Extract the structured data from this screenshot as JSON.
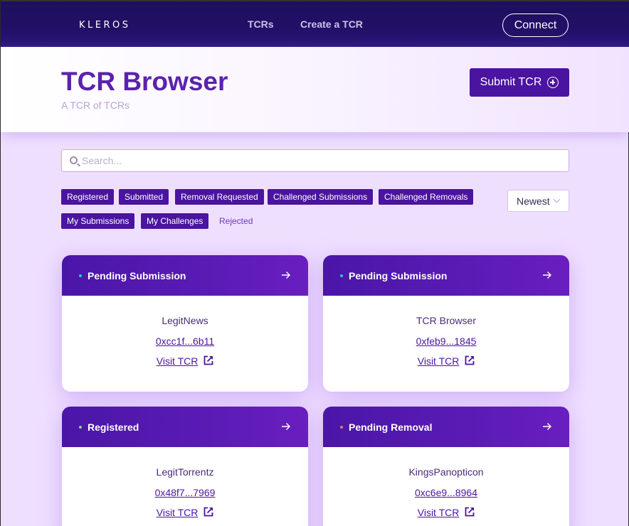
{
  "topbar": {
    "logo": "KLEROS",
    "nav": [
      {
        "label": "TCRs"
      },
      {
        "label": "Create a TCR"
      }
    ],
    "connect_label": "Connect"
  },
  "hero": {
    "title": "TCR Browser",
    "subtitle": "A TCR of TCRs",
    "submit_label": "Submit TCR"
  },
  "search": {
    "placeholder": "Search..."
  },
  "filters": [
    {
      "label": "Registered",
      "active": true
    },
    {
      "label": "Submitted",
      "active": true
    },
    {
      "label": "Removal Requested",
      "active": true
    },
    {
      "label": "Challenged Submissions",
      "active": true
    },
    {
      "label": "Challenged Removals",
      "active": true
    },
    {
      "label": "My Submissions",
      "active": true
    },
    {
      "label": "My Challenges",
      "active": true
    },
    {
      "label": "Rejected",
      "active": false
    }
  ],
  "sort": {
    "selected": "Newest"
  },
  "cards": [
    {
      "status": "Pending Submission",
      "status_color": "#1bd0d8",
      "name": "LegitNews",
      "address": "0xcc1f...6b11",
      "visit_label": "Visit TCR"
    },
    {
      "status": "Pending Submission",
      "status_color": "#1bd0d8",
      "name": "TCR Browser",
      "address": "0xfeb9...1845",
      "visit_label": "Visit TCR"
    },
    {
      "status": "Registered",
      "status_color": "#7be07b",
      "name": "LegitTorrentz",
      "address": "0x48f7...7969",
      "visit_label": "Visit TCR"
    },
    {
      "status": "Pending Removal",
      "status_color": "#f07a5a",
      "name": "KingsPanopticon",
      "address": "0xc6e9...8964",
      "visit_label": "Visit TCR"
    }
  ],
  "colors": {
    "accent": "#4a14a0",
    "title": "#5b22ae",
    "background": "#efdfff"
  }
}
